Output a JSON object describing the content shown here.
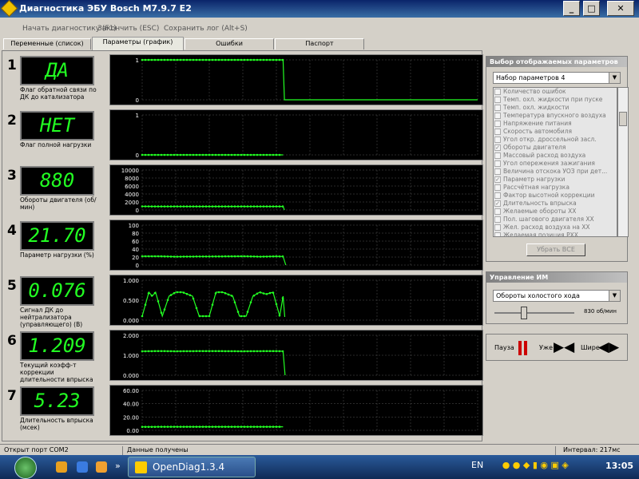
{
  "window": {
    "title": "Диагностика ЭБУ Bosch M7.9.7 E2"
  },
  "menu": [
    "Начать диагностику (F1)",
    "Закончить (ESC)",
    "Сохранить лог (Alt+S)"
  ],
  "tabs": [
    {
      "label": "Переменные (список)",
      "active": false
    },
    {
      "label": "Параметры (график)",
      "active": true
    },
    {
      "label": "Ошибки",
      "active": false
    },
    {
      "label": "Паспорт",
      "active": false
    }
  ],
  "rows": [
    {
      "num": "1",
      "value": "ДА",
      "label": "Флаг обратной связи по ДК до катализатора",
      "chart_data": {
        "type": "line",
        "yticks": [
          "1",
          "0"
        ],
        "ylim": [
          0,
          1
        ],
        "x": [
          0,
          0.02,
          0.1,
          0.2,
          0.3,
          0.4,
          0.42,
          0.424,
          1
        ],
        "y": [
          1,
          1,
          1,
          1,
          1,
          1,
          1,
          0,
          0
        ],
        "end_x": 0.424
      }
    },
    {
      "num": "2",
      "value": "НЕТ",
      "label": "Флаг полной нагрузки",
      "chart_data": {
        "type": "line",
        "yticks": [
          "1",
          "0"
        ],
        "ylim": [
          0,
          1
        ],
        "x": [
          0,
          0.42
        ],
        "y": [
          0,
          0
        ],
        "end_x": 0.42
      }
    },
    {
      "num": "3",
      "value": "880",
      "label": "Обороты двигателя (об/мин)",
      "chart_data": {
        "type": "line",
        "yticks": [
          "10000",
          "8000",
          "6000",
          "4000",
          "2000",
          "0"
        ],
        "ylim": [
          0,
          10000
        ],
        "x": [
          0,
          0.05,
          0.1,
          0.2,
          0.3,
          0.4,
          0.42,
          0.424
        ],
        "y": [
          900,
          880,
          870,
          880,
          890,
          880,
          880,
          0
        ],
        "end_x": 0.424
      }
    },
    {
      "num": "4",
      "value": "21.70",
      "label": "Параметр нагрузки (%)",
      "chart_data": {
        "type": "line",
        "yticks": [
          "100",
          "80",
          "60",
          "40",
          "20",
          "0"
        ],
        "ylim": [
          0,
          100
        ],
        "x": [
          0,
          0.05,
          0.1,
          0.2,
          0.3,
          0.35,
          0.4,
          0.42,
          0.428
        ],
        "y": [
          22,
          22,
          21,
          21.5,
          22,
          21,
          21.7,
          21.5,
          0
        ],
        "end_x": 0.428
      }
    },
    {
      "num": "5",
      "value": "0.076",
      "label": "Сигнал ДК до нейтрализатора (управляющего) (В)",
      "chart_data": {
        "type": "line",
        "yticks": [
          "1.000",
          "0.500",
          "0.000"
        ],
        "ylim": [
          0,
          1
        ],
        "x": [
          0,
          0.02,
          0.03,
          0.04,
          0.06,
          0.08,
          0.1,
          0.12,
          0.15,
          0.17,
          0.2,
          0.22,
          0.24,
          0.27,
          0.29,
          0.31,
          0.33,
          0.35,
          0.37,
          0.39,
          0.41,
          0.42,
          0.425
        ],
        "y": [
          0.1,
          0.7,
          0.6,
          0.7,
          0.1,
          0.6,
          0.7,
          0.7,
          0.6,
          0.1,
          0.1,
          0.7,
          0.7,
          0.6,
          0.1,
          0.1,
          0.6,
          0.7,
          0.65,
          0.7,
          0.1,
          0.6,
          0.08
        ],
        "end_x": 0.425
      }
    },
    {
      "num": "6",
      "value": "1.209",
      "label": "Текущий коэфф-т коррекции длительности впрыска",
      "chart_data": {
        "type": "line",
        "yticks": [
          "2.000",
          "1.000",
          "0.000"
        ],
        "ylim": [
          0,
          2
        ],
        "x": [
          0,
          0.05,
          0.1,
          0.2,
          0.3,
          0.4,
          0.42,
          0.426
        ],
        "y": [
          1.2,
          1.21,
          1.2,
          1.21,
          1.2,
          1.21,
          1.2,
          0
        ],
        "end_x": 0.426
      }
    },
    {
      "num": "7",
      "value": "5.23",
      "label": "Длительность впрыска (мсек)",
      "chart_data": {
        "type": "line",
        "yticks": [
          "60.00",
          "40.00",
          "20.00",
          "0.00"
        ],
        "ylim": [
          0,
          60
        ],
        "x": [
          0,
          0.2,
          0.42
        ],
        "y": [
          5.2,
          5.3,
          5.23
        ],
        "end_x": 0.42
      }
    }
  ],
  "params_panel": {
    "title": "Выбор отображаемых параметров",
    "set": "Набор параметров 4",
    "items": [
      {
        "label": "Количество ошибок",
        "checked": false
      },
      {
        "label": "Темп. охл. жидкости при пуске",
        "checked": false
      },
      {
        "label": "Темп. охл. жидкости",
        "checked": false
      },
      {
        "label": "Температура впускного воздуха",
        "checked": false
      },
      {
        "label": "Напряжение питания",
        "checked": false
      },
      {
        "label": "Скорость автомобиля",
        "checked": false
      },
      {
        "label": "Угол откр. дроссельной засл.",
        "checked": false
      },
      {
        "label": "Обороты двигателя",
        "checked": true
      },
      {
        "label": "Массовый расход воздуха",
        "checked": false
      },
      {
        "label": "Угол опережения зажигания",
        "checked": false
      },
      {
        "label": "Величина отскока УОЗ при дет...",
        "checked": false
      },
      {
        "label": "Параметр нагрузки",
        "checked": true
      },
      {
        "label": "Рассчётная нагрузка",
        "checked": false
      },
      {
        "label": "Фактор высотной коррекции",
        "checked": false
      },
      {
        "label": "Длительность впрыска",
        "checked": true
      },
      {
        "label": "Желаемые обороты ХХ",
        "checked": false
      },
      {
        "label": "Пол. шагового двигателя ХХ",
        "checked": false
      },
      {
        "label": "Жел. расход воздуха на ХХ",
        "checked": false
      },
      {
        "label": "Желаемая позиция РХХ",
        "checked": false
      }
    ],
    "clear_btn": "Убрать ВСЕ"
  },
  "control_panel": {
    "title": "Управление ИМ",
    "select": "Обороты холостого хода",
    "slider_value": "830 об/мин",
    "slider_level": 0.33
  },
  "playback": {
    "pause": "Пауза",
    "narrow": "Уже",
    "wide": "Шире"
  },
  "status": {
    "port": "Открыт порт COM2",
    "data": "Данные получены",
    "interval": "Интервал: 217мс"
  },
  "taskbar": {
    "app": "OpenDiag1.3.4",
    "lang": "EN",
    "time": "13:05"
  },
  "colors": {
    "accent": "#22ff22",
    "chart_bg": "#000000",
    "grid": "#555555"
  }
}
